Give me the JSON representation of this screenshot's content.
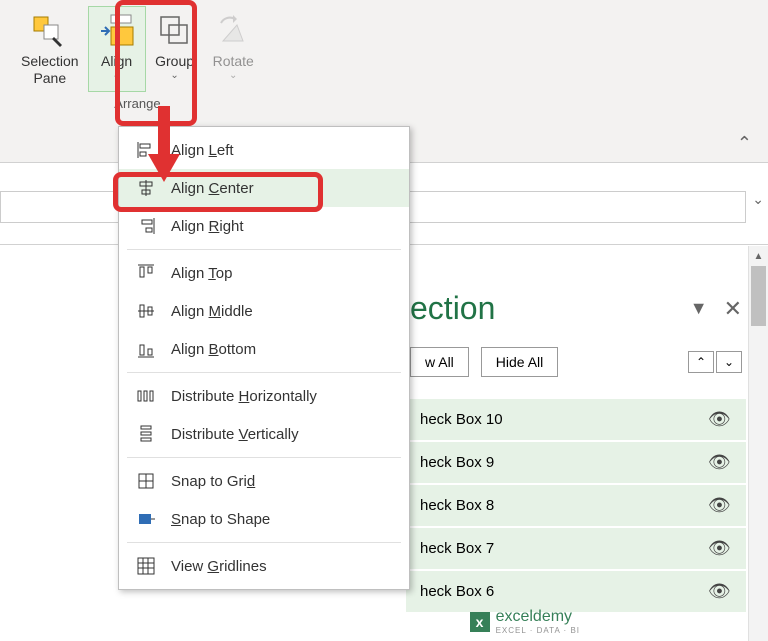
{
  "ribbon": {
    "group_label": "Arrange",
    "buttons": {
      "selection_pane": "Selection\nPane",
      "align": "Align",
      "group": "Group",
      "rotate": "Rotate"
    }
  },
  "menu": {
    "align_left": "Align Left",
    "align_center": "Align Center",
    "align_right": "Align Right",
    "align_top": "Align Top",
    "align_middle": "Align Middle",
    "align_bottom": "Align Bottom",
    "distribute_h": "Distribute Horizontally",
    "distribute_v": "Distribute Vertically",
    "snap_grid": "Snap to Grid",
    "snap_shape": "Snap to Shape",
    "view_gridlines": "View Gridlines"
  },
  "pane": {
    "title_suffix": "ection",
    "show_all": "w All",
    "hide_all": "Hide All",
    "items": [
      "heck Box 10",
      "heck Box 9",
      "heck Box 8",
      "heck Box 7",
      "heck Box 6"
    ]
  },
  "watermark": {
    "brand": "exceldemy",
    "sub": "EXCEL · DATA · BI"
  }
}
